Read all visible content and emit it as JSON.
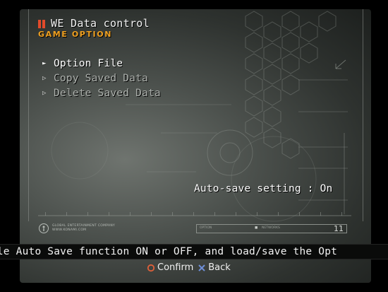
{
  "header": {
    "title": "WE Data control",
    "subtitle": "GAME OPTION",
    "title_mark_color": "#e24a2a",
    "subtitle_color": "#f0a020"
  },
  "menu": {
    "items": [
      {
        "label": "Option File",
        "selected": true
      },
      {
        "label": "Copy Saved Data",
        "selected": false
      },
      {
        "label": "Delete Saved Data",
        "selected": false
      }
    ]
  },
  "status": {
    "text": "Auto-save setting : On"
  },
  "footer": {
    "logo_text_line1": "GLOBAL ENTERTAINMENT COMPANY",
    "logo_text_line2": "WWW.KONAMI.COM",
    "statusbar_cell1": "OPTION",
    "statusbar_cell2": "NETWORKS",
    "statusbar_number": "11"
  },
  "help": {
    "text": "File Auto Save function ON or OFF, and load/save the Opt"
  },
  "controls": {
    "confirm_label": "Confirm",
    "back_label": "Back",
    "confirm_icon": "circle-button-icon",
    "back_icon": "cross-button-icon",
    "confirm_color": "#e0603a",
    "back_color": "#6f8fd8"
  }
}
